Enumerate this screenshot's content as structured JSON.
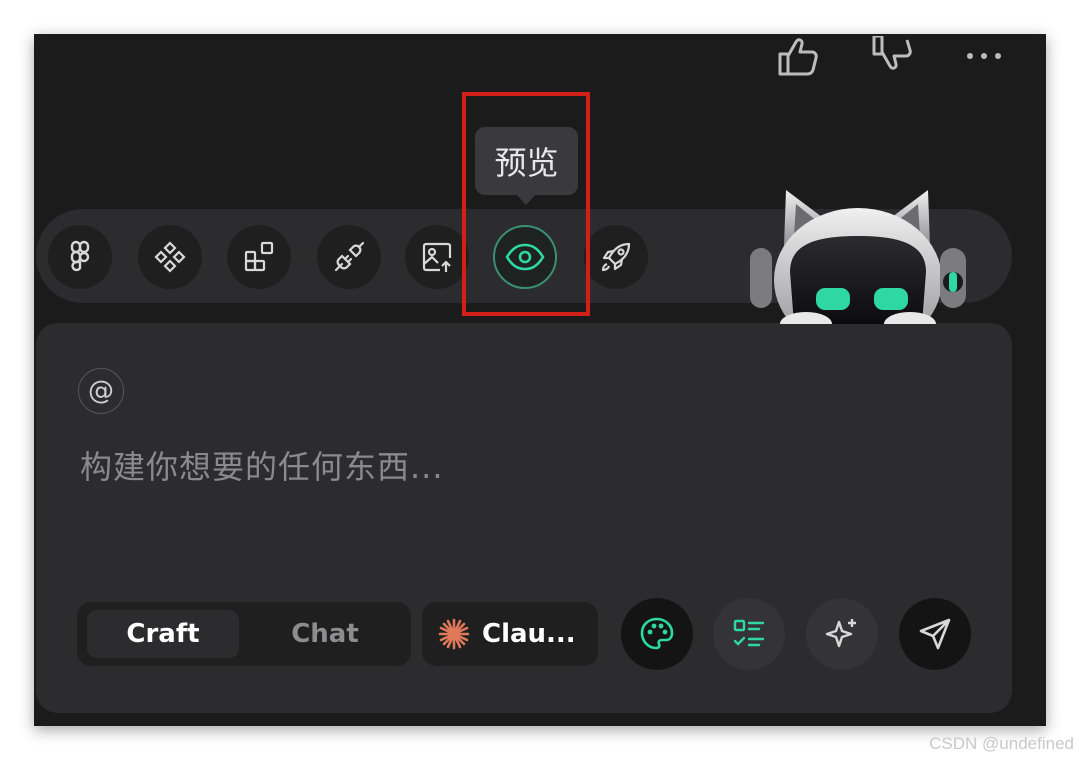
{
  "topbar": {
    "like_icon": "thumbs-up-icon",
    "dislike_icon": "thumbs-down-icon",
    "more_icon": "more-horizontal-icon"
  },
  "toolbar": {
    "tools": [
      {
        "icon": "figma-icon"
      },
      {
        "icon": "components-icon"
      },
      {
        "icon": "blocks-icon"
      },
      {
        "icon": "plug-icon"
      },
      {
        "icon": "image-upload-icon"
      },
      {
        "icon": "eye-icon",
        "active": true
      },
      {
        "icon": "rocket-icon"
      }
    ],
    "tooltip": "预览"
  },
  "composer": {
    "mention_symbol": "@",
    "placeholder": "构建你想要的任何东西...",
    "mode": {
      "selected": "Craft",
      "other": "Chat"
    },
    "model_label": "Clau...",
    "actions": [
      "palette-icon",
      "checklist-icon",
      "sparkle-icon",
      "send-icon"
    ]
  },
  "colors": {
    "accent": "#2fd8a0",
    "highlight_box": "#d21f18",
    "model_logo": "#e0785a"
  },
  "watermark": "CSDN @undefined"
}
